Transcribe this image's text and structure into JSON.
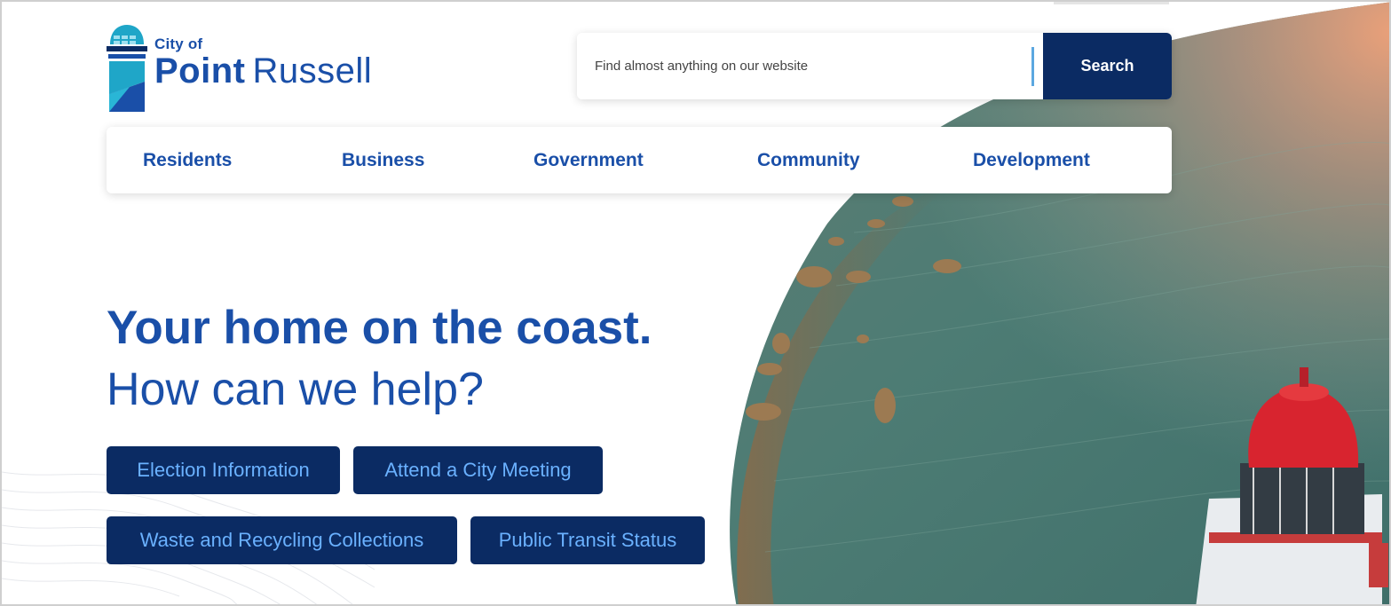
{
  "logo": {
    "city_of": "City of",
    "name_bold": "Point",
    "name_regular": "Russell"
  },
  "search": {
    "placeholder": "Find almost anything on our website",
    "button_label": "Search"
  },
  "nav": {
    "items": [
      {
        "label": "Residents"
      },
      {
        "label": "Business"
      },
      {
        "label": "Government"
      },
      {
        "label": "Community"
      },
      {
        "label": "Development"
      }
    ]
  },
  "hero": {
    "headline": "Your home on the coast.",
    "subline": "How can we help?",
    "quick_links": [
      {
        "label": "Election Information"
      },
      {
        "label": "Attend a City Meeting"
      },
      {
        "label": "Waste and Recycling Collections"
      },
      {
        "label": "Public Transit Status"
      }
    ]
  },
  "colors": {
    "brand_blue": "#1a4fa8",
    "navy": "#0b2b63",
    "button_text": "#6ab1ff",
    "teal": "#1fa6c8"
  }
}
